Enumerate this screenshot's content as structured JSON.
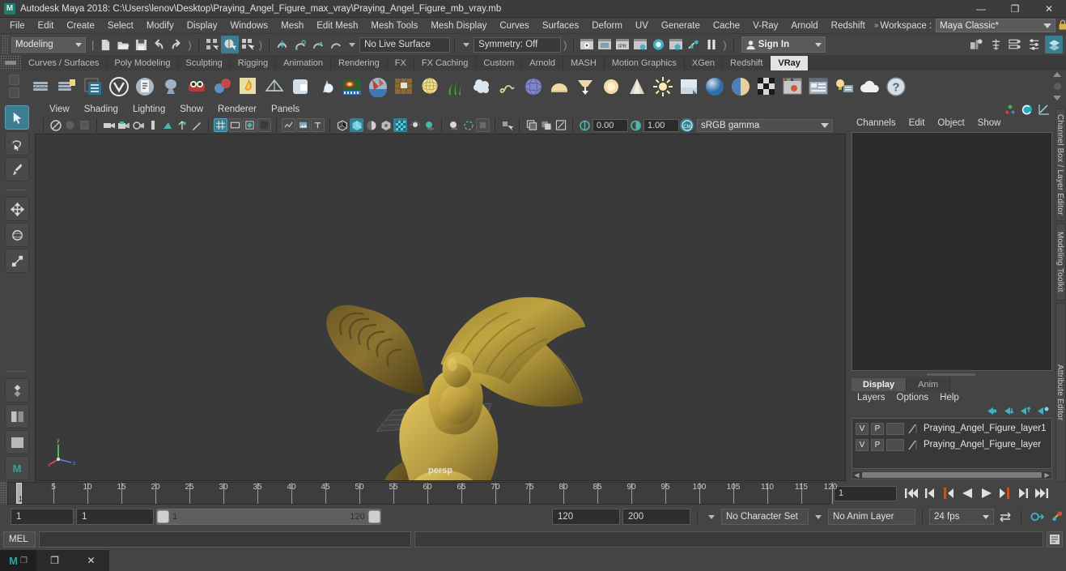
{
  "window": {
    "title": "Autodesk Maya 2018: C:\\Users\\lenov\\Desktop\\Praying_Angel_Figure_max_vray\\Praying_Angel_Figure_mb_vray.mb",
    "logo_text": "M",
    "minimize": "—",
    "maximize": "❐",
    "close": "✕"
  },
  "menubar": {
    "items": [
      "File",
      "Edit",
      "Create",
      "Select",
      "Modify",
      "Display",
      "Windows",
      "Mesh",
      "Edit Mesh",
      "Mesh Tools",
      "Mesh Display",
      "Curves",
      "Surfaces",
      "Deform",
      "UV",
      "Generate",
      "Cache",
      "V-Ray",
      "Arnold",
      "Redshift"
    ],
    "overflow_chevron": "»",
    "workspace_label": "Workspace :",
    "workspace_value": "Maya Classic*",
    "lock_icon": "lock-icon"
  },
  "statusbar": {
    "mode_value": "Modeling",
    "live_surface": "No Live Surface",
    "symmetry": "Symmetry: Off",
    "signin_label": "Sign In",
    "icons": [
      "new-scene-icon",
      "open-scene-icon",
      "save-scene-icon",
      "undo-icon",
      "redo-icon",
      "select-by-hierarchy-icon",
      "select-by-object-icon",
      "select-by-component-icon",
      "snap-to-grid-icon",
      "snap-to-curve-icon",
      "snap-to-point-icon",
      "snap-to-projected-icon",
      "render-current-frame-icon",
      "ipr-render-icon",
      "render-settings-icon",
      "hypershade-icon",
      "render-view-icon",
      "render-sequence-icon",
      "pause-render-icon",
      "open-attribute-editor-icon",
      "open-tool-settings-icon",
      "open-channel-box-icon",
      "open-modeling-toolkit-icon",
      "layer-editor-icon"
    ]
  },
  "shelf": {
    "tabs": [
      "Curves / Surfaces",
      "Poly Modeling",
      "Sculpting",
      "Rigging",
      "Animation",
      "Rendering",
      "FX",
      "FX Caching",
      "Custom",
      "Arnold",
      "MASH",
      "Motion Graphics",
      "XGen",
      "Redshift",
      "VRay"
    ],
    "selected_tab": "VRay",
    "icons": [
      "vray-render-icon",
      "vray-render-settings-icon",
      "vray-attributes-icon",
      "vray-logo-icon",
      "vray-scene-icon",
      "vray-proxy-icon",
      "vray-fur-icon",
      "vray-material-icon",
      "vray-displacement-icon",
      "vray-clipper-icon",
      "vray-mesh-light-icon",
      "vray-object-properties-icon",
      "vray-volume-icon",
      "vray-distance-tex-icon",
      "vray-triplanar-icon",
      "vray-dirt-icon",
      "vray-sky-icon",
      "vray-fur-grass-icon",
      "vray-particles-icon",
      "vray-curve-icon",
      "vray-sphere-light-icon",
      "vray-dome-light-icon",
      "vray-ies-light-icon",
      "vray-ambient-light-icon",
      "vray-rect-light-icon",
      "vray-sun-icon",
      "vray-plane-icon",
      "vray-sphere-icon",
      "vray-glass-icon",
      "vray-checker-icon",
      "vray-frame-buffer-icon",
      "vray-vfb-settings-icon",
      "vray-light-lister-icon",
      "vray-cloud-icon",
      "vray-help-icon"
    ]
  },
  "toolbox": {
    "tools": [
      "select-tool",
      "lasso-select-tool",
      "paint-select-tool",
      "move-tool",
      "rotate-tool",
      "scale-tool",
      "last-tool-used",
      "show-manipulator-tool",
      "outliner-persp-layout",
      "persp-layout",
      "four-view-layout",
      "maya-logo"
    ],
    "active": "select-tool"
  },
  "viewport": {
    "menus": [
      "View",
      "Shading",
      "Lighting",
      "Show",
      "Renderer",
      "Panels"
    ],
    "camera_label": "persp",
    "exposure": "0.00",
    "gamma": "1.00",
    "color_space": "sRGB gamma",
    "toolbar_icons": [
      "select-camera-icon",
      "lock-camera-icon",
      "camera-attributes-icon",
      "bookmark-icon",
      "image-plane-icon",
      "two-d-pan-zoom-icon",
      "grease-pencil-icon",
      "grid-icon",
      "film-gate-icon",
      "resolution-gate-icon",
      "gate-mask-icon",
      "xray-icon",
      "xray-joints-icon",
      "exposure-icon",
      "wireframe-icon",
      "smooth-shade-all-icon",
      "shade-wireframe-icon",
      "textured-icon",
      "use-lights-icon",
      "shadows-icon",
      "ao-icon",
      "motion-blur-icon",
      "multisample-icon",
      "isolate-select-icon",
      "display-layers-icon",
      "snapshot-icon",
      "viewport-grab-icon"
    ]
  },
  "channel_box": {
    "header_icons": [
      "show-manipulator-icon",
      "attribute-editor-icon",
      "graph-editor-icon"
    ],
    "side_tabs": [
      "Channel Box / Layer Editor",
      "Modeling Toolkit",
      "Attribute Editor"
    ],
    "menus": [
      "Channels",
      "Edit",
      "Object",
      "Show"
    ]
  },
  "layer_editor": {
    "tabs": [
      "Display",
      "Anim"
    ],
    "selected_tab": "Display",
    "menus": [
      "Layers",
      "Options",
      "Help"
    ],
    "buttons": [
      "create-empty-layer-icon",
      "create-layer-from-selected-icon",
      "select-objects-in-layer-icon",
      "add-selected-to-layer-icon"
    ],
    "layers": [
      {
        "visibility": "V",
        "playback": "P",
        "shading": "",
        "name": "Praying_Angel_Figure_layer1",
        "color": "#9a9a9a"
      },
      {
        "visibility": "V",
        "playback": "P",
        "shading": "",
        "name": "Praying_Angel_Figure_layer",
        "color": "#9a9a9a"
      }
    ]
  },
  "timeline": {
    "tick_labels": [
      "5",
      "10",
      "15",
      "20",
      "25",
      "30",
      "35",
      "40",
      "45",
      "50",
      "55",
      "60",
      "65",
      "70",
      "75",
      "80",
      "85",
      "90",
      "95",
      "100",
      "105",
      "110",
      "115",
      "120"
    ],
    "current_frame_marker": "1",
    "current_frame_field": "1",
    "playback_buttons": [
      "go-to-start-icon",
      "step-back-keyframe-icon",
      "step-back-frame-icon",
      "play-backwards-icon",
      "play-forwards-icon",
      "step-forward-frame-icon",
      "step-forward-keyframe-icon",
      "go-to-end-icon"
    ]
  },
  "range_slider": {
    "anim_start": "1",
    "range_start": "1",
    "slider_start_label": "1",
    "slider_end_label": "120",
    "range_end": "120",
    "anim_end": "200",
    "character_set": "No Character Set",
    "anim_layer": "No Anim Layer",
    "fps": "24 fps",
    "icons": [
      "auto-key-icon",
      "animation-preferences-icon"
    ]
  },
  "command_line": {
    "label": "MEL",
    "input_value": "",
    "output_value": "",
    "script-editor-button": "script-editor-icon"
  },
  "taskbar": {
    "items": [
      "maya-taskbar-icon",
      "window-restore-icon",
      "window-close-icon"
    ],
    "maya_letter": "M"
  },
  "colors": {
    "chrome": "#444444",
    "accent": "#3d7d92",
    "viewport_bg": "#3a3a3a",
    "model_gold": "#b59a42",
    "selected_tab": "#e3e3e3"
  }
}
